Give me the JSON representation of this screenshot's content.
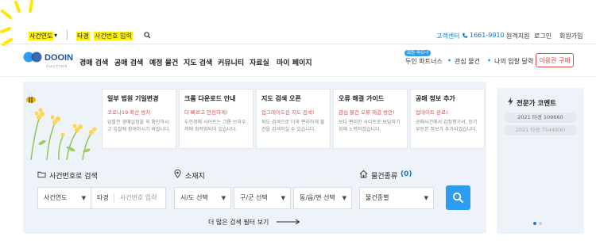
{
  "topbar": {
    "case_year": "사건연도",
    "tagyeong": "타경",
    "case_placeholder": "사건번호 입력",
    "customer_center": "고객센터",
    "phone": "1661-9910",
    "remote_support": "원격지원",
    "login": "로그인",
    "signup": "회원가입"
  },
  "logo": {
    "main": "DOOIN",
    "sub": "AUCTION"
  },
  "nav": {
    "items": [
      "경매 검색",
      "공매 검색",
      "예정 물건",
      "지도 검색",
      "커뮤니티",
      "자료실",
      "마이 페이지"
    ],
    "badge": "회원 파트너",
    "right": [
      "두인 파트너스",
      "관심 물건",
      "나의 입찰 달력"
    ],
    "buy_button": "이용권 구매"
  },
  "cards": [
    {
      "title": "일부 법원 기일변경",
      "sub": "코로나19 확산 방지",
      "desc": "입찰전 경매일정을 꼭 확인하시고 입찰에 참여하시기 바랍니다."
    },
    {
      "title": "크롬 다운로드 안내",
      "sub": "더 빠르고 안전하게!",
      "desc": "두인경매 사이트는 크롬 브라우저에 최적화되어 있습니다."
    },
    {
      "title": "지도 검색 오픈",
      "sub": "업그레이드된 지도 검색!",
      "desc": "지도 검색으로 더욱 편리하게 물건을 검색하실 수 있습니다."
    },
    {
      "title": "오류 해결 가이드",
      "sub": "관심 물건 오류 해결 방안!",
      "desc": "보다 편리한 사이트로 보답하기 위해 노력하겠습니다."
    },
    {
      "title": "공매 정보 추가",
      "sub": "업데이트 완료!",
      "desc": "공매사건에서 감정평가서, 등기부등본 정보가 추가되었습니다."
    }
  ],
  "search": {
    "case_label": "사건번호로 검색",
    "location_label": "소재지",
    "type_label": "물건종류",
    "type_count": "(0)",
    "case_year": "사건연도",
    "tagyeong": "타경",
    "case_placeholder": "사건번호 입력",
    "city": "시/도 선택",
    "district": "구/군 선택",
    "town": "동/읍/면 선택",
    "type_select": "물건종별",
    "more_filters": "더 많은 검색 필터 보기"
  },
  "expert": {
    "title": "전문가 코멘트",
    "items": [
      "2021 타경 109660",
      "2021 타경 75449(6)"
    ]
  },
  "colors": {
    "accent": "#2e9cf0",
    "highlight": "#fff200",
    "alert": "#e04848"
  }
}
